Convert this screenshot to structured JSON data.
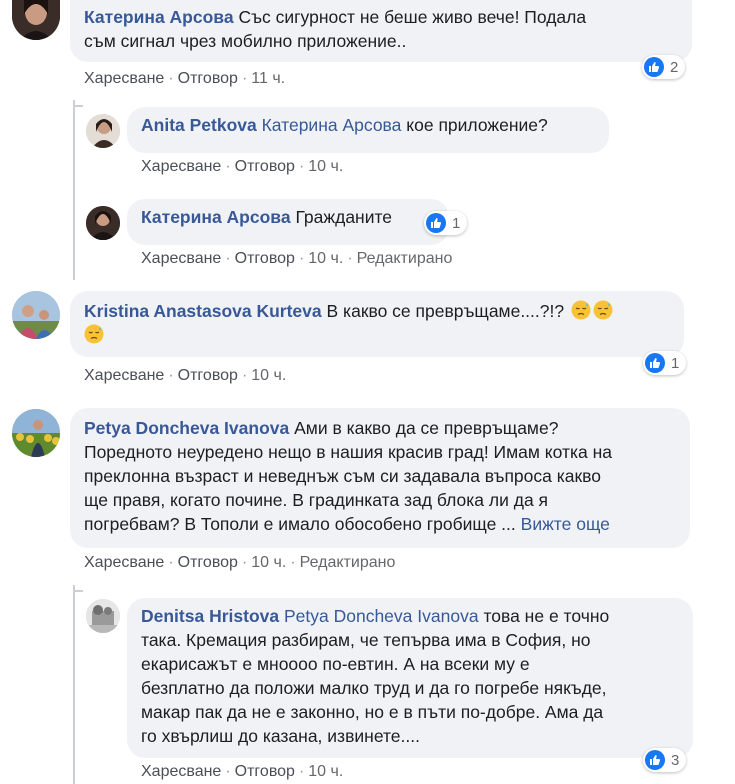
{
  "actions": {
    "like": "Харесване",
    "reply": "Отговор",
    "edited": "Редактирано",
    "dot": "·"
  },
  "comments": [
    {
      "author": "Катерина Арсова",
      "text_l1": "Със сигурност не беше живо вече! Подала",
      "text_l2": "съм сигнал чрез мобилно приложение..",
      "time": "11 ч.",
      "likes": "2"
    },
    {
      "author": "Anita Petkova",
      "mention": "Катерина Арсова",
      "text": "кое приложение?",
      "time": "10 ч."
    },
    {
      "author": "Катерина Арсова",
      "text": "Гражданите",
      "time": "10 ч.",
      "likes": "1"
    },
    {
      "author": "Kristina Anastasova Kurteva",
      "text": "В какво се превръщаме....?!?",
      "time": "10 ч.",
      "likes": "1"
    },
    {
      "author": "Petya Doncheva Ivanova",
      "text_l1": "Ами в какво да се превръщаме?",
      "text_l2": "Поредното неуредено нещо в нашия красив град! Имам котка на",
      "text_l3": "преклонна възраст и неведнъж съм си задавала въпроса какво",
      "text_l4": "ще правя, когато почине. В градинката зад блока ли да я",
      "text_l5": "погребвам? В Тополи е имало обособено гробище ...",
      "see_more": "Вижте още",
      "time": "10 ч."
    },
    {
      "author": "Denitsa Hristova",
      "mention": "Petya Doncheva Ivanova",
      "text_l1": "това не е точно",
      "text_l2": "така. Кремация разбирам, че тепърва има в София, но",
      "text_l3": "екарисажът е мноооо по-евтин. А на всеки му е",
      "text_l4": "безплатно да положи малко труд и да го погребе някъде,",
      "text_l5": "макар пак да не е законно, но е в пъти по-добре. Ама да",
      "text_l6": "го хвърлиш до казана, извинете....",
      "time": "10 ч.",
      "likes": "3"
    }
  ],
  "colors": {
    "bubble": "#f0f2f5",
    "author": "#385898",
    "like_blue": "#1877f2",
    "thread_line": "#ccd0d5"
  },
  "icons": {
    "like": "like-icon",
    "emoji": "downcast-face-with-sweat-emoji"
  }
}
